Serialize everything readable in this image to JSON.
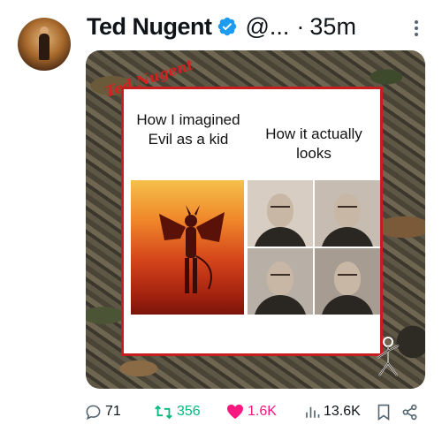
{
  "tweet": {
    "author_name": "Ted Nugent",
    "handle": "@...",
    "separator": "·",
    "time": "35m"
  },
  "media": {
    "signature": "Ted Nugent",
    "left_label": "How I imagined Evil as a kid",
    "right_label": "How it actually looks",
    "frame_color": "#c61e1e"
  },
  "actions": {
    "replies": "71",
    "reposts": "356",
    "likes": "1.6K",
    "views": "13.6K",
    "repost_color": "#00ba7c",
    "like_color": "#f91880"
  }
}
